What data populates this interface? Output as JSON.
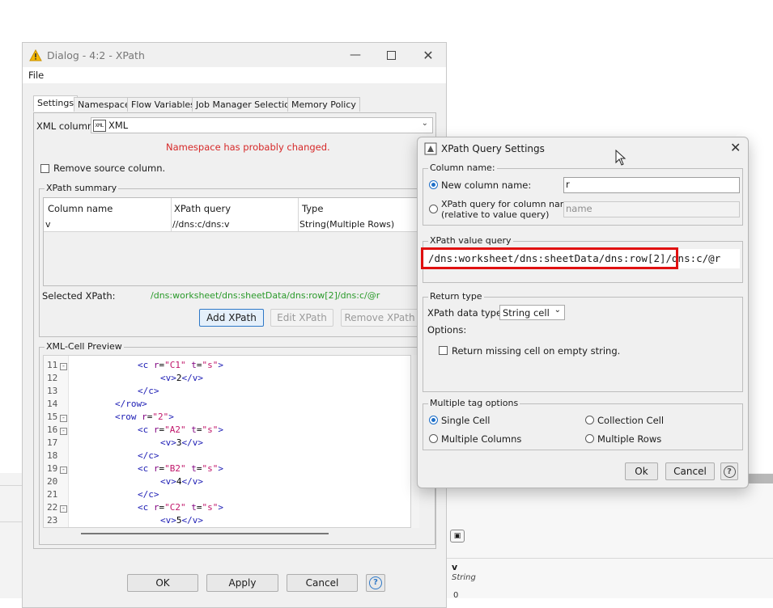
{
  "main_dialog": {
    "title": "Dialog - 4:2 - XPath",
    "menu_file": "File",
    "tabs": [
      "Settings",
      "Namespace",
      "Flow Variables",
      "Job Manager Selection",
      "Memory Policy"
    ],
    "xml_column_label": "XML column:",
    "xml_column_value": "XML",
    "xml_column_icon_text": "XML",
    "namespace_warning": "Namespace has probably changed.",
    "remove_source_label": "Remove source column.",
    "summary_group": "XPath summary",
    "table_headers": [
      "Column name",
      "XPath query",
      "Type"
    ],
    "table_row": [
      "v",
      "//dns:c/dns:v",
      "String(Multiple Rows)"
    ],
    "selected_xpath_label": "Selected XPath:",
    "selected_xpath_value": "/dns:worksheet/dns:sheetData/dns:row[2]/dns:c/@r",
    "add_xpath": "Add XPath",
    "edit_xpath": "Edit XPath",
    "remove_xpath": "Remove XPath",
    "preview_group": "XML-Cell Preview",
    "ok": "OK",
    "apply": "Apply",
    "cancel": "Cancel",
    "help": "?"
  },
  "preview_lines": [
    {
      "n": "11",
      "fold": true,
      "indent": 3,
      "parts": [
        [
          "tag",
          "<c "
        ],
        [
          "attr",
          "r"
        ],
        [
          "txt",
          "="
        ],
        [
          "val",
          "\"C1\""
        ],
        [
          "txt",
          " "
        ],
        [
          "attr",
          "t"
        ],
        [
          "txt",
          "="
        ],
        [
          "val",
          "\"s\""
        ],
        [
          "tag",
          ">"
        ]
      ]
    },
    {
      "n": "12",
      "fold": false,
      "indent": 4,
      "parts": [
        [
          "tag",
          "<v>"
        ],
        [
          "txt",
          "2"
        ],
        [
          "tag",
          "</v>"
        ]
      ]
    },
    {
      "n": "13",
      "fold": false,
      "indent": 3,
      "parts": [
        [
          "tag",
          "</c>"
        ]
      ]
    },
    {
      "n": "14",
      "fold": false,
      "indent": 2,
      "parts": [
        [
          "tag",
          "</row>"
        ]
      ]
    },
    {
      "n": "15",
      "fold": true,
      "indent": 2,
      "parts": [
        [
          "tag",
          "<row "
        ],
        [
          "attr",
          "r"
        ],
        [
          "txt",
          "="
        ],
        [
          "val",
          "\"2\""
        ],
        [
          "tag",
          ">"
        ]
      ]
    },
    {
      "n": "16",
      "fold": true,
      "indent": 3,
      "parts": [
        [
          "tag",
          "<c "
        ],
        [
          "attr",
          "r"
        ],
        [
          "txt",
          "="
        ],
        [
          "val",
          "\"A2\""
        ],
        [
          "txt",
          " "
        ],
        [
          "attr",
          "t"
        ],
        [
          "txt",
          "="
        ],
        [
          "val",
          "\"s\""
        ],
        [
          "tag",
          ">"
        ]
      ]
    },
    {
      "n": "17",
      "fold": false,
      "indent": 4,
      "parts": [
        [
          "tag",
          "<v>"
        ],
        [
          "txt",
          "3"
        ],
        [
          "tag",
          "</v>"
        ]
      ]
    },
    {
      "n": "18",
      "fold": false,
      "indent": 3,
      "parts": [
        [
          "tag",
          "</c>"
        ]
      ]
    },
    {
      "n": "19",
      "fold": true,
      "indent": 3,
      "parts": [
        [
          "tag",
          "<c "
        ],
        [
          "attr",
          "r"
        ],
        [
          "txt",
          "="
        ],
        [
          "val",
          "\"B2\""
        ],
        [
          "txt",
          " "
        ],
        [
          "attr",
          "t"
        ],
        [
          "txt",
          "="
        ],
        [
          "val",
          "\"s\""
        ],
        [
          "tag",
          ">"
        ]
      ]
    },
    {
      "n": "20",
      "fold": false,
      "indent": 4,
      "parts": [
        [
          "tag",
          "<v>"
        ],
        [
          "txt",
          "4"
        ],
        [
          "tag",
          "</v>"
        ]
      ]
    },
    {
      "n": "21",
      "fold": false,
      "indent": 3,
      "parts": [
        [
          "tag",
          "</c>"
        ]
      ]
    },
    {
      "n": "22",
      "fold": true,
      "indent": 3,
      "parts": [
        [
          "tag",
          "<c "
        ],
        [
          "attr",
          "r"
        ],
        [
          "txt",
          "="
        ],
        [
          "val",
          "\"C2\""
        ],
        [
          "txt",
          " "
        ],
        [
          "attr",
          "t"
        ],
        [
          "txt",
          "="
        ],
        [
          "val",
          "\"s\""
        ],
        [
          "tag",
          ">"
        ]
      ]
    },
    {
      "n": "23",
      "fold": false,
      "indent": 4,
      "parts": [
        [
          "tag",
          "<v>"
        ],
        [
          "txt",
          "5"
        ],
        [
          "tag",
          "</v>"
        ]
      ]
    }
  ],
  "query_dialog": {
    "title": "XPath Query Settings",
    "column_name_group": "Column name:",
    "new_column_label": "New column name:",
    "new_column_value": "r",
    "xpath_col_label_1": "XPath query for column name:",
    "xpath_col_label_2": "(relative to value query)",
    "xpath_col_placeholder": "name",
    "value_query_group": "XPath value query",
    "value_query": "/dns:worksheet/dns:sheetData/dns:row[2]/dns:c/@r",
    "return_type_group": "Return type",
    "data_type_label": "XPath data type:",
    "data_type_value": "String cell",
    "options_label": "Options:",
    "return_missing_label": "Return missing cell on empty string.",
    "multiple_tag_group": "Multiple tag options",
    "single_cell": "Single Cell",
    "collection_cell": "Collection Cell",
    "multiple_columns": "Multiple Columns",
    "multiple_rows": "Multiple Rows",
    "ok": "Ok",
    "cancel": "Cancel",
    "help": "?"
  },
  "background": {
    "column_name": "v",
    "column_type": "String",
    "row_value": "0"
  },
  "colors": {
    "warning": "#d62828",
    "xpath_green": "#2a9a2a",
    "highlight": "#e01010",
    "accent": "#1e6fc8"
  }
}
